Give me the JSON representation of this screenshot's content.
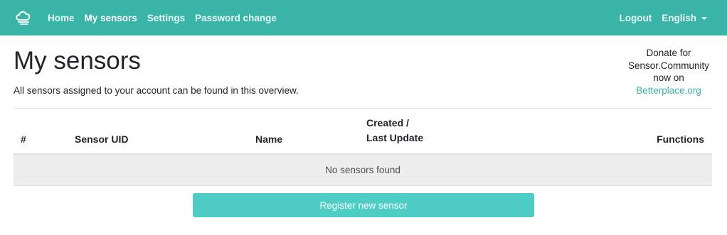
{
  "navbar": {
    "brand_icon": "cloud-logo-icon",
    "links": [
      "Home",
      "My sensors",
      "Settings",
      "Password change"
    ],
    "active": "My sensors",
    "logout": "Logout",
    "language": "English"
  },
  "header": {
    "title": "My sensors",
    "subtitle": "All sensors assigned to your account can be found in this overview."
  },
  "donate": {
    "line1": "Donate for",
    "line2": "Sensor.Community",
    "line3": "now on",
    "link": "Betterplace.org"
  },
  "table": {
    "columns": {
      "hash": "#",
      "uid": "Sensor UID",
      "name": "Name",
      "created_line1": "Created /",
      "created_line2": "Last Update",
      "functions": "Functions"
    },
    "empty_message": "No sensors found"
  },
  "register_button": "Register new sensor",
  "colors": {
    "navbar": "#3bb4a8",
    "button": "#4ecdc4",
    "link": "#3bb4a8"
  }
}
